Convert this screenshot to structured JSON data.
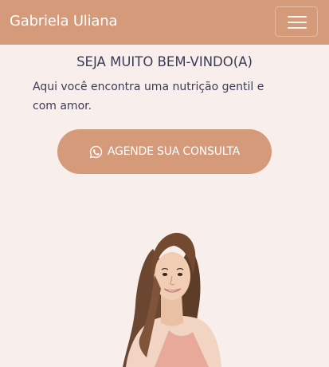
{
  "navbar": {
    "brand": "Gabriela Uliana",
    "menu_icon": "hamburger-menu-icon"
  },
  "hero": {
    "heading": "SEJA MUITO BEM-VINDO(A)",
    "intro": "Aqui você encontra uma nutrição gentil e com amor.",
    "cta_label": "AGENDE SUA CONSULTA",
    "cta_icon": "whatsapp-icon"
  },
  "colors": {
    "accent": "#d59a79",
    "background": "#f8efec",
    "text": "#3a3b55"
  }
}
